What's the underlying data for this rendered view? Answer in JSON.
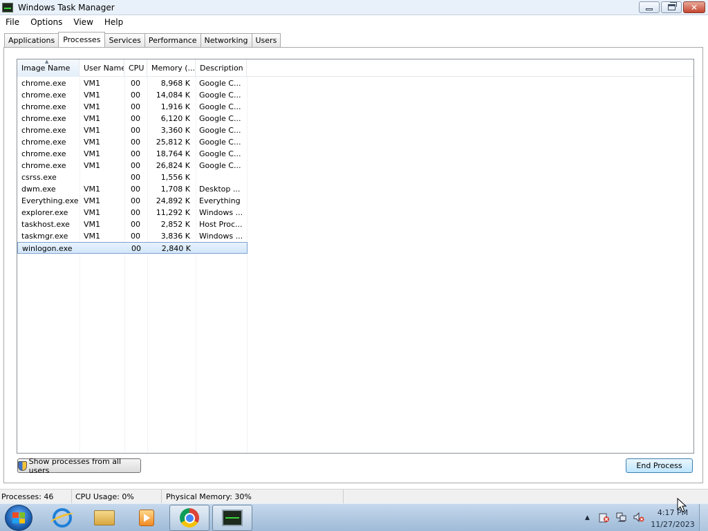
{
  "window": {
    "title": "Windows Task Manager",
    "minimize": "minimize",
    "maximize": "maximize",
    "close": "close"
  },
  "menu": [
    "File",
    "Options",
    "View",
    "Help"
  ],
  "tabs": [
    "Applications",
    "Processes",
    "Services",
    "Performance",
    "Networking",
    "Users"
  ],
  "active_tab": "Processes",
  "columns": {
    "image_name": "Image Name",
    "user_name": "User Name",
    "cpu": "CPU",
    "memory": "Memory (...",
    "description": "Description"
  },
  "processes": [
    {
      "name": "chrome.exe",
      "user": "VM1",
      "cpu": "00",
      "memory": "8,968 K",
      "desc": "Google C..."
    },
    {
      "name": "chrome.exe",
      "user": "VM1",
      "cpu": "00",
      "memory": "14,084 K",
      "desc": "Google C..."
    },
    {
      "name": "chrome.exe",
      "user": "VM1",
      "cpu": "00",
      "memory": "1,916 K",
      "desc": "Google C..."
    },
    {
      "name": "chrome.exe",
      "user": "VM1",
      "cpu": "00",
      "memory": "6,120 K",
      "desc": "Google C..."
    },
    {
      "name": "chrome.exe",
      "user": "VM1",
      "cpu": "00",
      "memory": "3,360 K",
      "desc": "Google C..."
    },
    {
      "name": "chrome.exe",
      "user": "VM1",
      "cpu": "00",
      "memory": "25,812 K",
      "desc": "Google C..."
    },
    {
      "name": "chrome.exe",
      "user": "VM1",
      "cpu": "00",
      "memory": "18,764 K",
      "desc": "Google C..."
    },
    {
      "name": "chrome.exe",
      "user": "VM1",
      "cpu": "00",
      "memory": "26,824 K",
      "desc": "Google C..."
    },
    {
      "name": "csrss.exe",
      "user": "",
      "cpu": "00",
      "memory": "1,556 K",
      "desc": ""
    },
    {
      "name": "dwm.exe",
      "user": "VM1",
      "cpu": "00",
      "memory": "1,708 K",
      "desc": "Desktop ..."
    },
    {
      "name": "Everything.exe",
      "user": "VM1",
      "cpu": "00",
      "memory": "24,892 K",
      "desc": "Everything"
    },
    {
      "name": "explorer.exe",
      "user": "VM1",
      "cpu": "00",
      "memory": "11,292 K",
      "desc": "Windows ..."
    },
    {
      "name": "taskhost.exe",
      "user": "VM1",
      "cpu": "00",
      "memory": "2,852 K",
      "desc": "Host Proc..."
    },
    {
      "name": "taskmgr.exe",
      "user": "VM1",
      "cpu": "00",
      "memory": "3,836 K",
      "desc": "Windows ..."
    },
    {
      "name": "winlogon.exe",
      "user": "",
      "cpu": "00",
      "memory": "2,840 K",
      "desc": "",
      "selected": true
    }
  ],
  "buttons": {
    "show_all": "Show processes from all users",
    "end_process": "End Process"
  },
  "status": {
    "processes": "Processes: 46",
    "cpu": "CPU Usage: 0%",
    "memory": "Physical Memory: 30%"
  },
  "taskbar": {
    "items": [
      "start-orb",
      "internet-explorer",
      "windows-explorer",
      "media-player",
      "google-chrome",
      "task-manager"
    ],
    "time": "4:17 PM",
    "date": "11/27/2023"
  }
}
